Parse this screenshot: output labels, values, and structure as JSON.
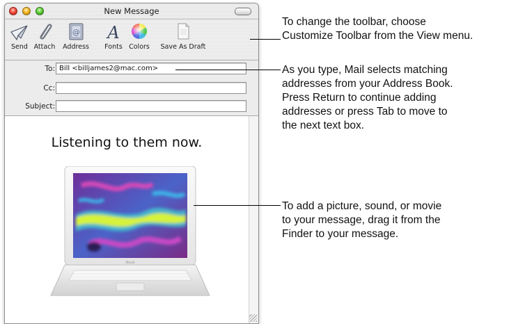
{
  "window": {
    "title": "New Message"
  },
  "toolbar": {
    "items": [
      {
        "label": "Send",
        "icon": "send-icon"
      },
      {
        "label": "Attach",
        "icon": "paperclip-icon"
      },
      {
        "label": "Address",
        "icon": "address-book-icon"
      },
      {
        "label": "Fonts",
        "icon": "fonts-icon"
      },
      {
        "label": "Colors",
        "icon": "color-wheel-icon"
      },
      {
        "label": "Save As Draft",
        "icon": "draft-document-icon"
      }
    ]
  },
  "headers": {
    "to_label": "To:",
    "to_value": "Bill <billjames2@mac.com>",
    "cc_label": "Cc:",
    "cc_value": "",
    "subject_label": "Subject:",
    "subject_value": ""
  },
  "message": {
    "headline": "Listening to them now.",
    "image": "ibook-laptop-photo",
    "laptop_brand": "iBook"
  },
  "callouts": {
    "toolbar": "To change the toolbar, choose\nCustomize Toolbar from the View menu.",
    "address": "As you type, Mail selects matching\naddresses from your Address Book.\nPress Return to continue adding\naddresses or press Tab to move to\nthe next text box.",
    "attachment": "To add a picture, sound, or movie\nto your message, drag it from the\nFinder to your message."
  },
  "colors": {
    "close": "#ee4a3c",
    "minimize": "#f3b526",
    "zoom": "#5fcb3a"
  }
}
